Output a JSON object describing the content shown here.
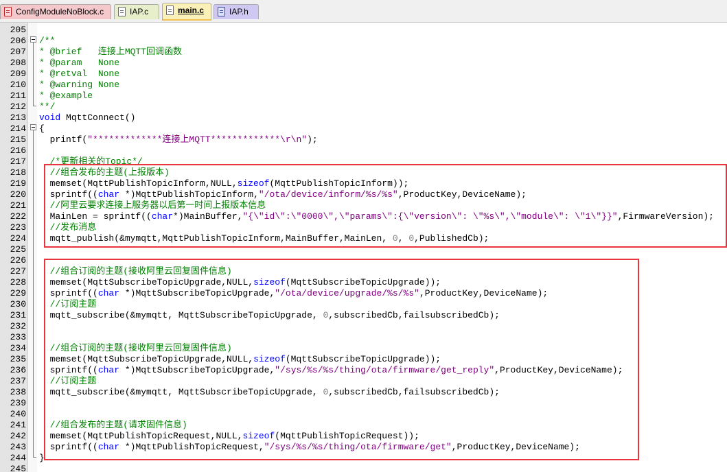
{
  "tabs": [
    {
      "label": "ConfigModuleNoBlock.c",
      "icon": "c-file-icon",
      "color": "#f5c8cc",
      "active": false
    },
    {
      "label": "IAP.c",
      "icon": "c-file-icon",
      "color": "#e6eeca",
      "active": false
    },
    {
      "label": "main.c",
      "icon": "c-file-icon",
      "color": "#fbf0b8",
      "active": true
    },
    {
      "label": "IAP.h",
      "icon": "h-file-icon",
      "color": "#cec8f2",
      "active": false
    }
  ],
  "editor": {
    "lines": [
      {
        "num": "205",
        "segs": []
      },
      {
        "num": "206",
        "segs": [
          {
            "t": "/**",
            "c": "cm"
          }
        ]
      },
      {
        "num": "207",
        "segs": [
          {
            "t": "* @brief   连接上MQTT回调函数",
            "c": "cm"
          }
        ]
      },
      {
        "num": "208",
        "segs": [
          {
            "t": "* @param   None",
            "c": "cm"
          }
        ]
      },
      {
        "num": "209",
        "segs": [
          {
            "t": "* @retval  None",
            "c": "cm"
          }
        ]
      },
      {
        "num": "210",
        "segs": [
          {
            "t": "* @warning None",
            "c": "cm"
          }
        ]
      },
      {
        "num": "211",
        "segs": [
          {
            "t": "* @example",
            "c": "cm"
          }
        ]
      },
      {
        "num": "212",
        "segs": [
          {
            "t": "**/",
            "c": "cm"
          }
        ]
      },
      {
        "num": "213",
        "segs": [
          {
            "t": "void",
            "c": "kw"
          },
          {
            "t": " MqttConnect()",
            "c": ""
          }
        ]
      },
      {
        "num": "214",
        "segs": [
          {
            "t": "{",
            "c": ""
          }
        ]
      },
      {
        "num": "215",
        "segs": [
          {
            "t": "  printf(",
            "c": ""
          },
          {
            "t": "\"*************连接上MQTT*************\\r\\n\"",
            "c": "st"
          },
          {
            "t": ");",
            "c": ""
          }
        ]
      },
      {
        "num": "216",
        "segs": []
      },
      {
        "num": "217",
        "segs": [
          {
            "t": "  /*更新相关的Topic*/",
            "c": "cm"
          }
        ]
      },
      {
        "num": "218",
        "segs": [
          {
            "t": "  //组合发布的主题(上报版本)",
            "c": "cm"
          }
        ]
      },
      {
        "num": "219",
        "segs": [
          {
            "t": "  memset(MqttPublishTopicInform,NULL,",
            "c": ""
          },
          {
            "t": "sizeof",
            "c": "kw"
          },
          {
            "t": "(MqttPublishTopicInform));",
            "c": ""
          }
        ]
      },
      {
        "num": "220",
        "segs": [
          {
            "t": "  sprintf((",
            "c": ""
          },
          {
            "t": "char",
            "c": "kw"
          },
          {
            "t": " *)MqttPublishTopicInform,",
            "c": ""
          },
          {
            "t": "\"/ota/device/inform/%s/%s\"",
            "c": "st"
          },
          {
            "t": ",ProductKey,DeviceName);",
            "c": ""
          }
        ]
      },
      {
        "num": "221",
        "segs": [
          {
            "t": "  //阿里云要求连接上服务器以后第一时间上报版本信息",
            "c": "cm"
          }
        ]
      },
      {
        "num": "222",
        "segs": [
          {
            "t": "  MainLen = sprintf((",
            "c": ""
          },
          {
            "t": "char",
            "c": "kw"
          },
          {
            "t": "*)MainBuffer,",
            "c": ""
          },
          {
            "t": "\"{\\\"id\\\":\\\"0000\\\",\\\"params\\\":{\\\"version\\\": \\\"%s\\\",\\\"module\\\": \\\"1\\\"}}\"",
            "c": "st"
          },
          {
            "t": ",FirmwareVersion);",
            "c": ""
          }
        ]
      },
      {
        "num": "223",
        "segs": [
          {
            "t": "  //发布消息",
            "c": "cm"
          }
        ]
      },
      {
        "num": "224",
        "segs": [
          {
            "t": "  mqtt_publish(&mymqtt,MqttPublishTopicInform,MainBuffer,MainLen, ",
            "c": ""
          },
          {
            "t": "0",
            "c": "nm"
          },
          {
            "t": ", ",
            "c": ""
          },
          {
            "t": "0",
            "c": "nm"
          },
          {
            "t": ",PublishedCb);",
            "c": ""
          }
        ]
      },
      {
        "num": "225",
        "segs": []
      },
      {
        "num": "226",
        "segs": []
      },
      {
        "num": "227",
        "segs": [
          {
            "t": "  //组合订阅的主题(接收阿里云回复固件信息)",
            "c": "cm"
          }
        ]
      },
      {
        "num": "228",
        "segs": [
          {
            "t": "  memset(MqttSubscribeTopicUpgrade,NULL,",
            "c": ""
          },
          {
            "t": "sizeof",
            "c": "kw"
          },
          {
            "t": "(MqttSubscribeTopicUpgrade));",
            "c": ""
          }
        ]
      },
      {
        "num": "229",
        "segs": [
          {
            "t": "  sprintf((",
            "c": ""
          },
          {
            "t": "char",
            "c": "kw"
          },
          {
            "t": " *)MqttSubscribeTopicUpgrade,",
            "c": ""
          },
          {
            "t": "\"/ota/device/upgrade/%s/%s\"",
            "c": "st"
          },
          {
            "t": ",ProductKey,DeviceName);",
            "c": ""
          }
        ]
      },
      {
        "num": "230",
        "segs": [
          {
            "t": "  //订阅主题",
            "c": "cm"
          }
        ]
      },
      {
        "num": "231",
        "segs": [
          {
            "t": "  mqtt_subscribe(&mymqtt, MqttSubscribeTopicUpgrade, ",
            "c": ""
          },
          {
            "t": "0",
            "c": "nm"
          },
          {
            "t": ",subscribedCb,failsubscribedCb);",
            "c": ""
          }
        ]
      },
      {
        "num": "232",
        "segs": []
      },
      {
        "num": "233",
        "segs": []
      },
      {
        "num": "234",
        "segs": [
          {
            "t": "  //组合订阅的主题(接收阿里云回复固件信息)",
            "c": "cm"
          }
        ]
      },
      {
        "num": "235",
        "segs": [
          {
            "t": "  memset(MqttSubscribeTopicUpgrade,NULL,",
            "c": ""
          },
          {
            "t": "sizeof",
            "c": "kw"
          },
          {
            "t": "(MqttSubscribeTopicUpgrade));",
            "c": ""
          }
        ]
      },
      {
        "num": "236",
        "segs": [
          {
            "t": "  sprintf((",
            "c": ""
          },
          {
            "t": "char",
            "c": "kw"
          },
          {
            "t": " *)MqttSubscribeTopicUpgrade,",
            "c": ""
          },
          {
            "t": "\"/sys/%s/%s/thing/ota/firmware/get_reply\"",
            "c": "st"
          },
          {
            "t": ",ProductKey,DeviceName);",
            "c": ""
          }
        ]
      },
      {
        "num": "237",
        "segs": [
          {
            "t": "  //订阅主题",
            "c": "cm"
          }
        ]
      },
      {
        "num": "238",
        "segs": [
          {
            "t": "  mqtt_subscribe(&mymqtt, MqttSubscribeTopicUpgrade, ",
            "c": ""
          },
          {
            "t": "0",
            "c": "nm"
          },
          {
            "t": ",subscribedCb,failsubscribedCb);",
            "c": ""
          }
        ]
      },
      {
        "num": "239",
        "segs": []
      },
      {
        "num": "240",
        "segs": []
      },
      {
        "num": "241",
        "segs": [
          {
            "t": "  //组合发布的主题(请求固件信息)",
            "c": "cm"
          }
        ]
      },
      {
        "num": "242",
        "segs": [
          {
            "t": "  memset(MqttPublishTopicRequest,NULL,",
            "c": ""
          },
          {
            "t": "sizeof",
            "c": "kw"
          },
          {
            "t": "(MqttPublishTopicRequest));",
            "c": ""
          }
        ]
      },
      {
        "num": "243",
        "segs": [
          {
            "t": "  sprintf((",
            "c": ""
          },
          {
            "t": "char",
            "c": "kw"
          },
          {
            "t": " *)MqttPublishTopicRequest,",
            "c": ""
          },
          {
            "t": "\"/sys/%s/%s/thing/ota/firmware/get\"",
            "c": "st"
          },
          {
            "t": ",ProductKey,DeviceName);",
            "c": ""
          }
        ]
      },
      {
        "num": "244",
        "segs": [
          {
            "t": "}",
            "c": ""
          }
        ]
      },
      {
        "num": "245",
        "segs": []
      }
    ]
  },
  "colors": {
    "comment": "#008000",
    "keyword": "#0000ff",
    "string": "#800080",
    "number": "#808080",
    "highlight_border": "#e8343c",
    "gutter": "#e4e4e4"
  }
}
